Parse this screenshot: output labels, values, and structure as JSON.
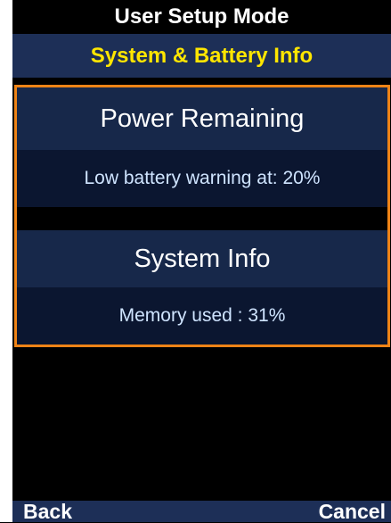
{
  "header": {
    "mode": "User Setup Mode",
    "title": "System & Battery Info"
  },
  "sections": {
    "power": {
      "heading": "Power Remaining",
      "detail": "Low battery warning at: 20%"
    },
    "system": {
      "heading": "System Info",
      "detail": "Memory used : 31%"
    }
  },
  "softkeys": {
    "left": "Back",
    "right": "Cancel"
  },
  "colors": {
    "title_text": "#ffe600",
    "title_bar": "#1d2f57",
    "focus_border": "#ee8316",
    "section_header": "#17284a",
    "section_row": "#0b1630"
  }
}
